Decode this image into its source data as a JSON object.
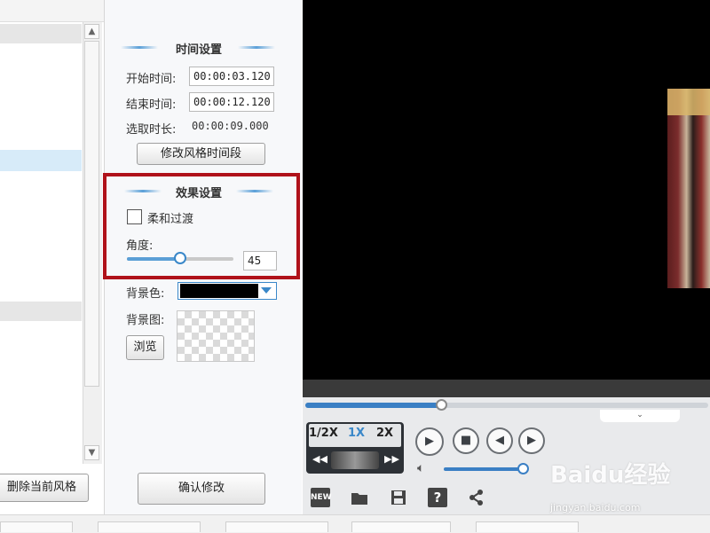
{
  "left_panel": {
    "delete_button_label": "删除当前风格"
  },
  "time_settings": {
    "title": "时间设置",
    "start_label": "开始时间:",
    "start_value": "00:00:03.120",
    "end_label": "结束时间:",
    "end_value": "00:00:12.120",
    "duration_label": "选取时长:",
    "duration_value": "00:00:09.000",
    "modify_button_label": "修改风格时间段"
  },
  "effect_settings": {
    "title": "效果设置",
    "soft_transition_label": "柔和过渡",
    "soft_transition_checked": false,
    "angle_label": "角度:",
    "angle_value": "45",
    "angle_slider_fraction": 0.5
  },
  "background": {
    "color_label": "背景色:",
    "color_value": "#000000",
    "image_label": "背景图:",
    "browse_button_label": "浏览"
  },
  "confirm_button_label": "确认修改",
  "player": {
    "speeds": [
      "1/2X",
      "1X",
      "2X"
    ],
    "active_speed": "1X",
    "progress_fraction": 0.34,
    "volume_fraction": 0.95,
    "icons": [
      "play-icon",
      "stop-icon",
      "prev-frame-icon",
      "next-frame-icon",
      "volume-icon"
    ],
    "toolbar_icons": [
      "new-icon",
      "open-folder-icon",
      "save-icon",
      "help-icon",
      "share-icon"
    ],
    "new_icon_text": "NEW",
    "help_icon_text": "?"
  },
  "watermark": {
    "text": "Baidu经验",
    "url_text": "jingyan.baidu.com"
  },
  "colors": {
    "accent_blue": "#3a7fc4",
    "highlight_red": "#b0121a",
    "video_bg": "#000000"
  }
}
